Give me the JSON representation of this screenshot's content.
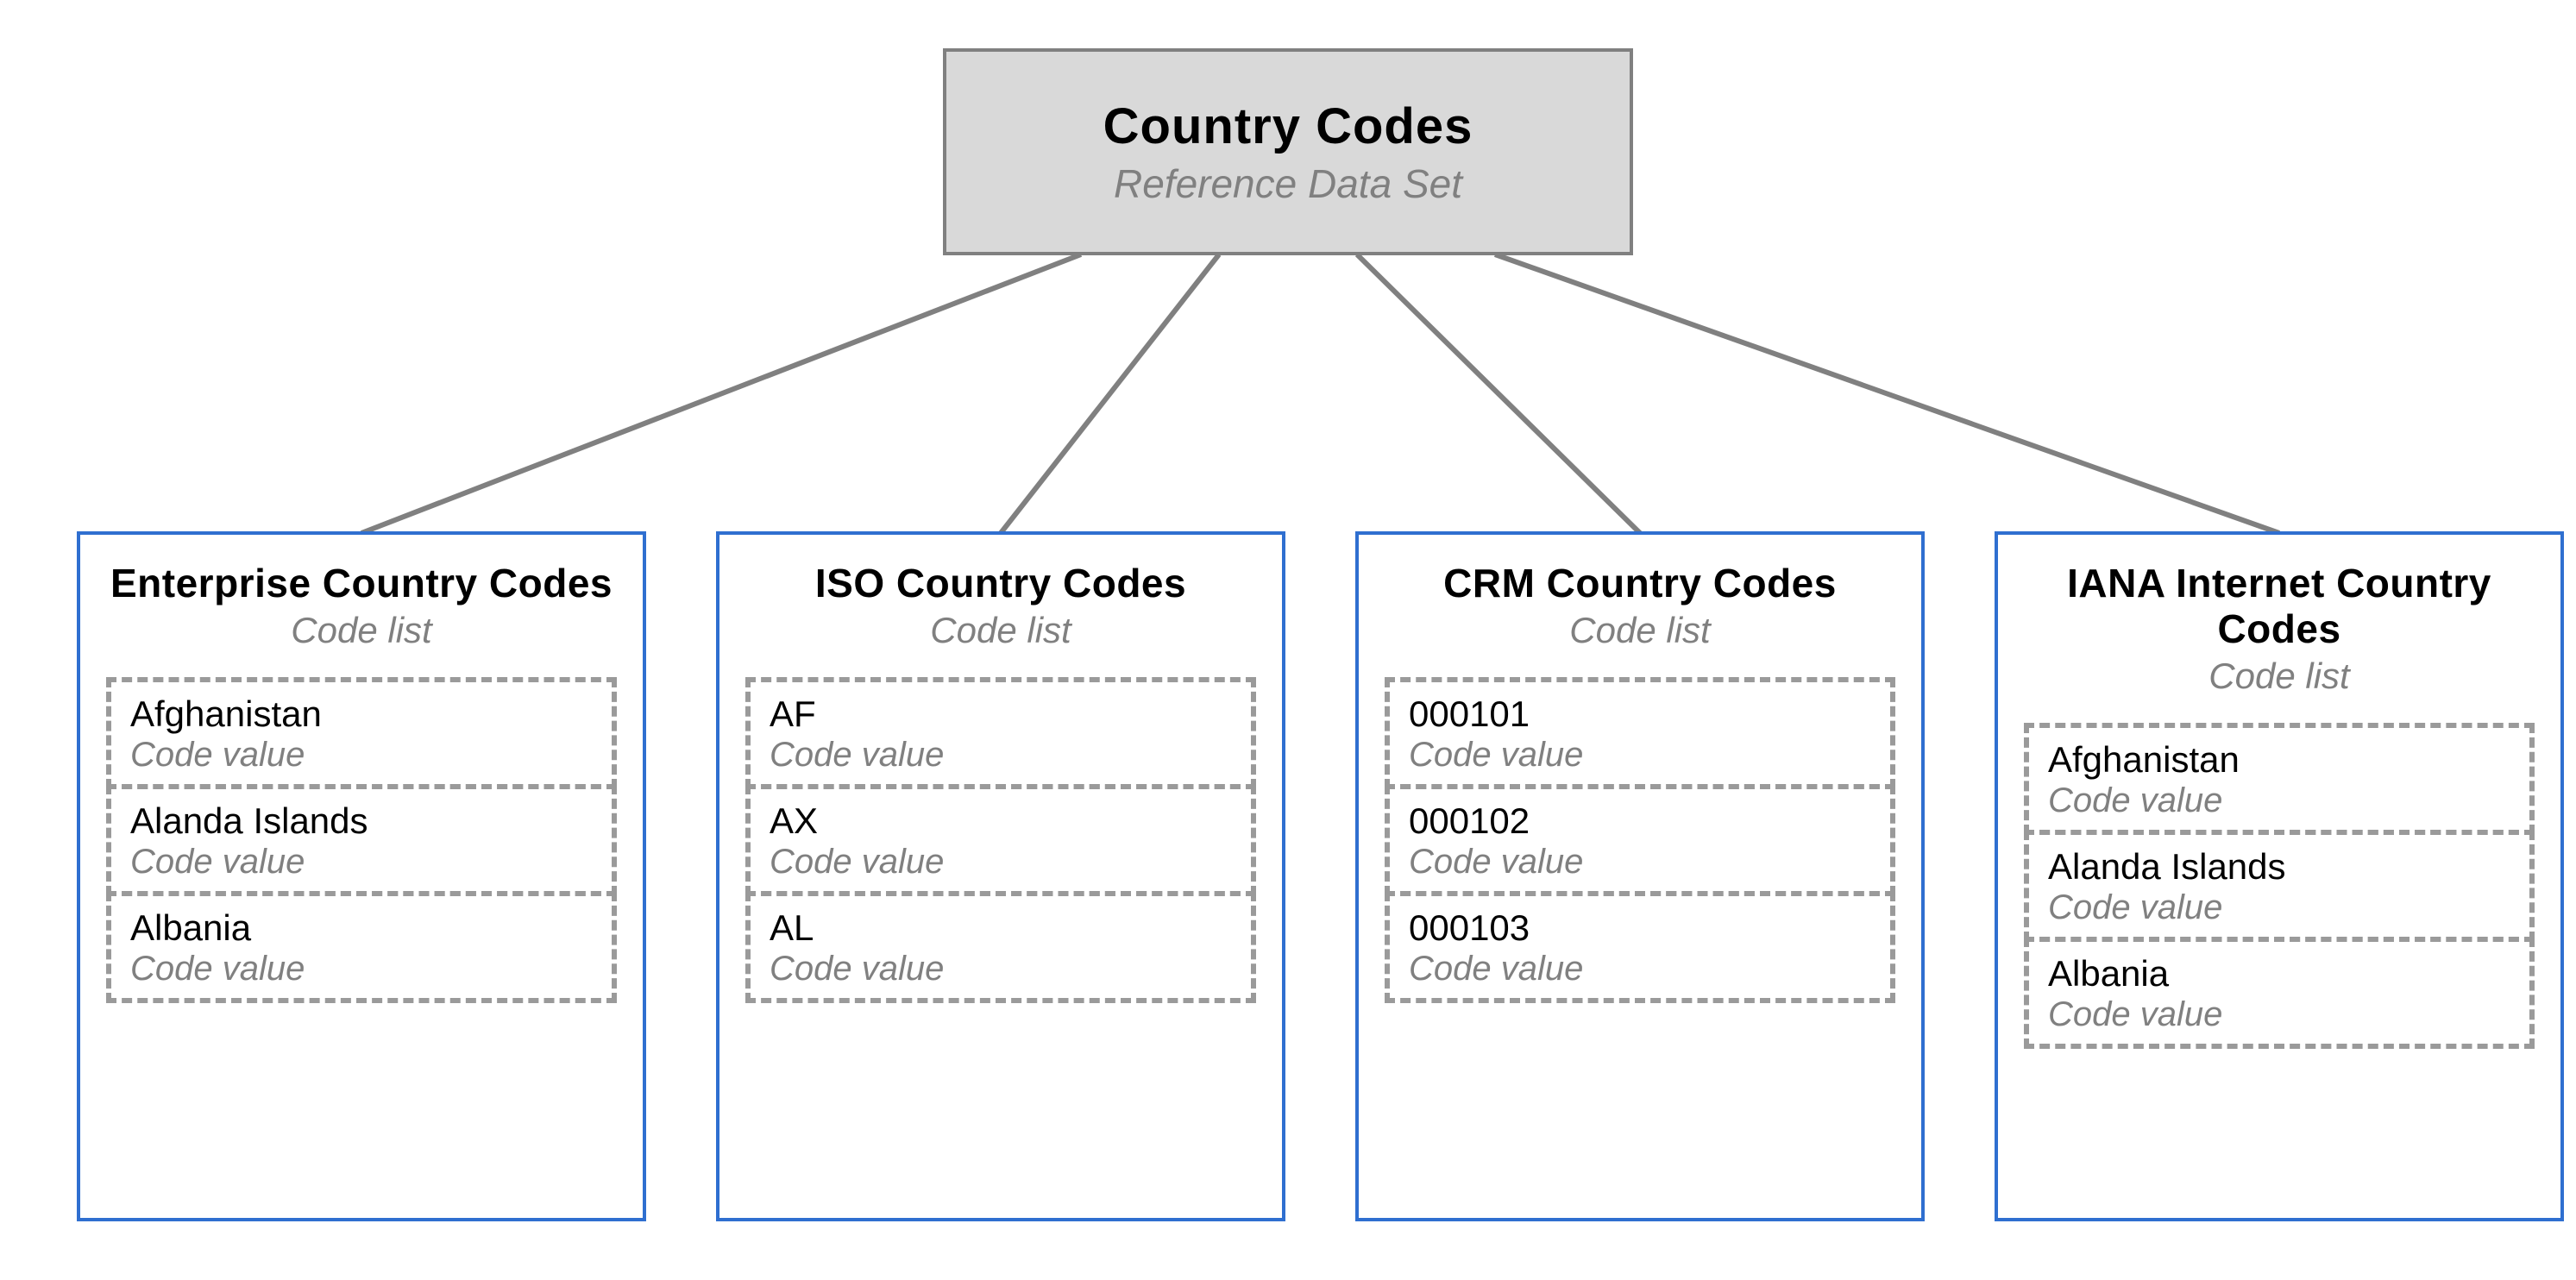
{
  "root": {
    "title": "Country Codes",
    "subtitle": "Reference Data Set"
  },
  "lists": [
    {
      "title": "Enterprise Country Codes",
      "subtitle": "Code list",
      "items": [
        {
          "value": "Afghanistan",
          "label": "Code value"
        },
        {
          "value": "Alanda Islands",
          "label": "Code value"
        },
        {
          "value": "Albania",
          "label": "Code value"
        }
      ]
    },
    {
      "title": "ISO Country Codes",
      "subtitle": "Code list",
      "items": [
        {
          "value": "AF",
          "label": "Code value"
        },
        {
          "value": "AX",
          "label": "Code value"
        },
        {
          "value": "AL",
          "label": "Code value"
        }
      ]
    },
    {
      "title": "CRM Country Codes",
      "subtitle": "Code list",
      "items": [
        {
          "value": "000101",
          "label": "Code value"
        },
        {
          "value": "000102",
          "label": "Code value"
        },
        {
          "value": "000103",
          "label": "Code value"
        }
      ]
    },
    {
      "title": "IANA Internet Country Codes",
      "subtitle": "Code list",
      "items": [
        {
          "value": "Afghanistan",
          "label": "Code value"
        },
        {
          "value": "Alanda Islands",
          "label": "Code value"
        },
        {
          "value": "Albania",
          "label": "Code value"
        }
      ]
    }
  ]
}
